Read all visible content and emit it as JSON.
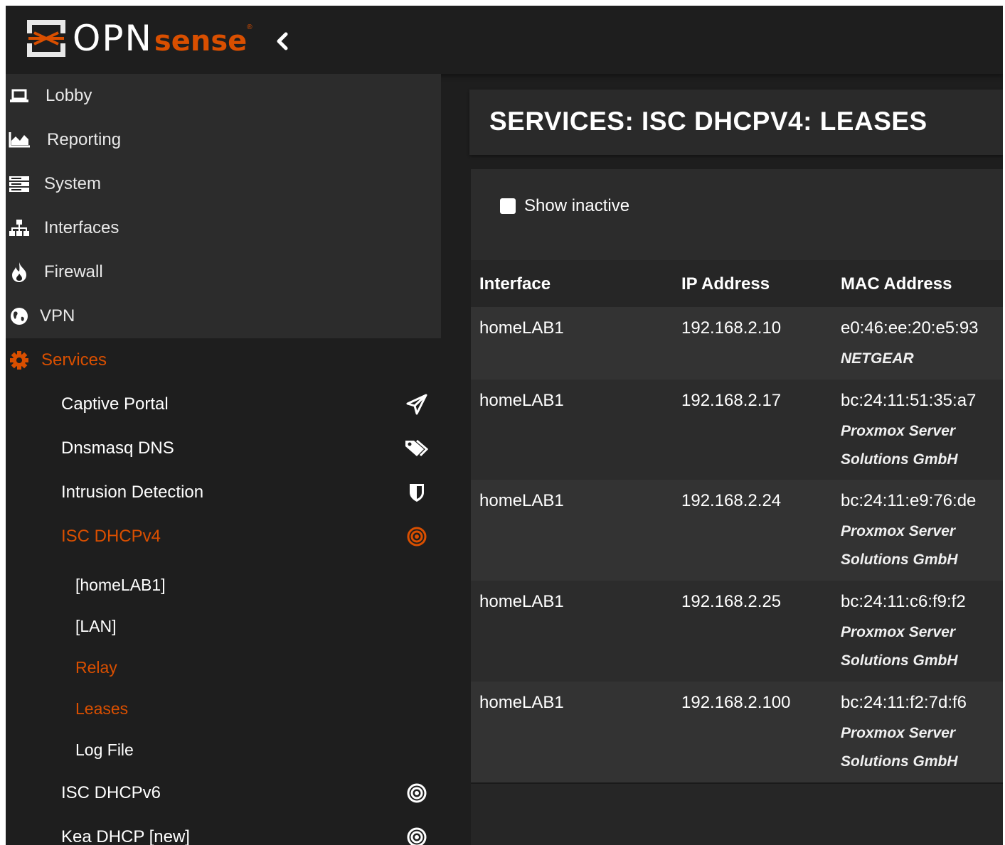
{
  "brand": {
    "logo_text_main": "OPN",
    "logo_text_accent": "sense",
    "logo_reg": "®"
  },
  "colors": {
    "accent": "#d94f00",
    "background": "#1e1e1e",
    "panel": "#2a2a2a",
    "text": "#e6e6e6"
  },
  "sidebar": {
    "items": [
      {
        "label": "Lobby",
        "icon": "laptop-icon"
      },
      {
        "label": "Reporting",
        "icon": "area-chart-icon"
      },
      {
        "label": "System",
        "icon": "server-icon"
      },
      {
        "label": "Interfaces",
        "icon": "sitemap-icon"
      },
      {
        "label": "Firewall",
        "icon": "fire-icon"
      },
      {
        "label": "VPN",
        "icon": "globe-icon"
      },
      {
        "label": "Services",
        "icon": "gear-icon",
        "active": true
      }
    ],
    "services_children": [
      {
        "label": "Captive Portal",
        "icon": "paper-plane-icon"
      },
      {
        "label": "Dnsmasq DNS",
        "icon": "tags-icon"
      },
      {
        "label": "Intrusion Detection",
        "icon": "shield-icon"
      },
      {
        "label": "ISC DHCPv4",
        "icon": "bullseye-icon",
        "active": true
      },
      {
        "label": "ISC DHCPv6",
        "icon": "bullseye-icon"
      },
      {
        "label": "Kea DHCP [new]",
        "icon": "bullseye-icon"
      }
    ],
    "dhcpv4_children": [
      {
        "label": "[homeLAB1]"
      },
      {
        "label": "[LAN]"
      },
      {
        "label": "Relay",
        "active": true
      },
      {
        "label": "Leases",
        "active": true
      },
      {
        "label": "Log File"
      }
    ]
  },
  "page": {
    "title": "SERVICES: ISC DHCPV4: LEASES",
    "show_inactive_label": "Show inactive",
    "show_inactive_checked": false
  },
  "table": {
    "headers": [
      "Interface",
      "IP Address",
      "MAC Address"
    ],
    "rows": [
      {
        "interface": "homeLAB1",
        "ip": "192.168.2.10",
        "mac": "e0:46:ee:20:e5:93",
        "vendor_lines": [
          "NETGEAR"
        ]
      },
      {
        "interface": "homeLAB1",
        "ip": "192.168.2.17",
        "mac": "bc:24:11:51:35:a7",
        "vendor_lines": [
          "Proxmox Server",
          "Solutions GmbH"
        ]
      },
      {
        "interface": "homeLAB1",
        "ip": "192.168.2.24",
        "mac": "bc:24:11:e9:76:de",
        "vendor_lines": [
          "Proxmox Server",
          "Solutions GmbH"
        ]
      },
      {
        "interface": "homeLAB1",
        "ip": "192.168.2.25",
        "mac": "bc:24:11:c6:f9:f2",
        "vendor_lines": [
          "Proxmox Server",
          "Solutions GmbH"
        ]
      },
      {
        "interface": "homeLAB1",
        "ip": "192.168.2.100",
        "mac": "bc:24:11:f2:7d:f6",
        "vendor_lines": [
          "Proxmox Server",
          "Solutions GmbH"
        ]
      }
    ]
  }
}
